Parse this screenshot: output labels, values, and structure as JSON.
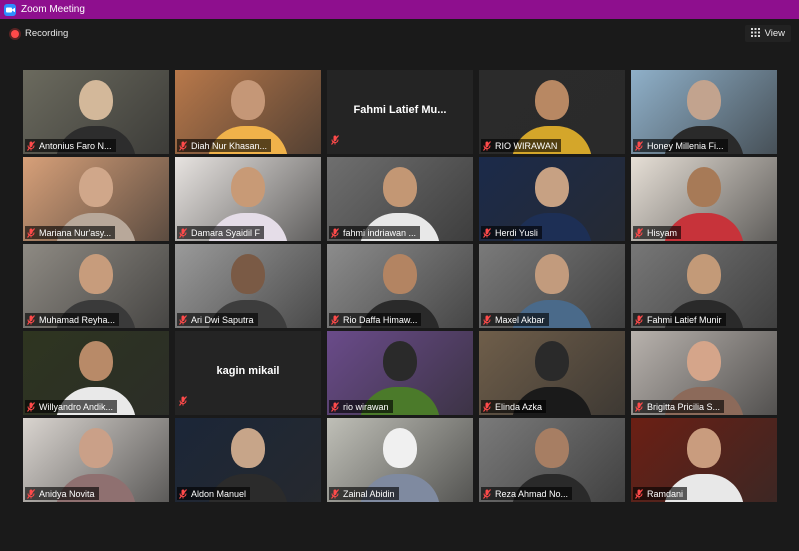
{
  "window": {
    "title": "Zoom Meeting"
  },
  "toolbar": {
    "recording_label": "Recording",
    "view_label": "View"
  },
  "colors": {
    "titlebar": "#8e0f8e",
    "active_speaker": "#c6f02a",
    "muted_mic": "#ff4a4a"
  },
  "participants": [
    {
      "name": "Antonius Faro N...",
      "video": true
    },
    {
      "name": "Diah Nur Khasan...",
      "video": true
    },
    {
      "name": "Fahmi Latief Mu...",
      "video": false
    },
    {
      "name": "RIO WIRAWAN",
      "video": true,
      "active": true
    },
    {
      "name": "Honey Millenia Fi...",
      "video": true
    },
    {
      "name": "Mariana Nur'asy...",
      "video": true
    },
    {
      "name": "Damara Syaidil F",
      "video": true
    },
    {
      "name": "fahmi indriawan ...",
      "video": true
    },
    {
      "name": "Herdi Yusli",
      "video": true
    },
    {
      "name": "Hisyam",
      "video": true
    },
    {
      "name": "Muhamad Reyha...",
      "video": true
    },
    {
      "name": "Ari Dwi Saputra",
      "video": true
    },
    {
      "name": "Rio Daffa Himaw...",
      "video": true
    },
    {
      "name": "Maxel Akbar",
      "video": true
    },
    {
      "name": "Fahmi Latief Munir",
      "video": true
    },
    {
      "name": "Willyandro Andik...",
      "video": true
    },
    {
      "name": "kagin mikail",
      "video": false
    },
    {
      "name": "rio wirawan",
      "video": true
    },
    {
      "name": "Elinda Azka",
      "video": true
    },
    {
      "name": "Brigitta Pricilia S...",
      "video": true
    },
    {
      "name": "Anidya Novita",
      "video": true
    },
    {
      "name": "Aldon Manuel",
      "video": true
    },
    {
      "name": "Zainal Abidin",
      "video": true
    },
    {
      "name": "Reza Ahmad No...",
      "video": true
    },
    {
      "name": "Ramdani",
      "video": true
    }
  ]
}
